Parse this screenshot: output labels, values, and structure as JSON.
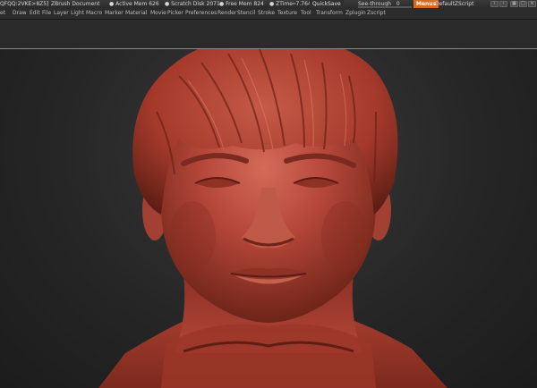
{
  "title_bar": {
    "doc_id": "QFQQ:2VKE>8Z5]",
    "doc_name": "ZBrush Document",
    "active_mem": "● Active Mem 626",
    "scratch_disk": "● Scratch Disk 2071",
    "free_mem": "● Free Mem 824",
    "ztime": "● ZTime┅7.764 T",
    "quicksave_label": "QuickSave",
    "see_through_label": "See-through",
    "see_through_value": "0",
    "see_through_level": 0.0,
    "menus_label": "Menus",
    "default_zscript_label": "DefaultZScript"
  },
  "menu_bar": {
    "items": [
      "et",
      "Draw",
      "Edit",
      "File",
      "Layer",
      "Light",
      "Macro",
      "Marker",
      "Material",
      "Movie",
      "Picker",
      "Preferences",
      "Render",
      "Stencil",
      "Stroke",
      "Texture",
      "Tool",
      "Transform",
      "Zplugin",
      "Zscript"
    ]
  },
  "colors": {
    "clay": "#b5473a",
    "clay_shadow": "#7a2a20",
    "clay_highlight": "#d67060",
    "accent_orange": "#d86a1a"
  },
  "icons": {
    "tb_1": "arrow-left-icon",
    "tb_2": "arrow-right-icon",
    "tb_3": "layout-icon",
    "tb_4": "maximize-icon",
    "tb_5": "close-icon"
  }
}
